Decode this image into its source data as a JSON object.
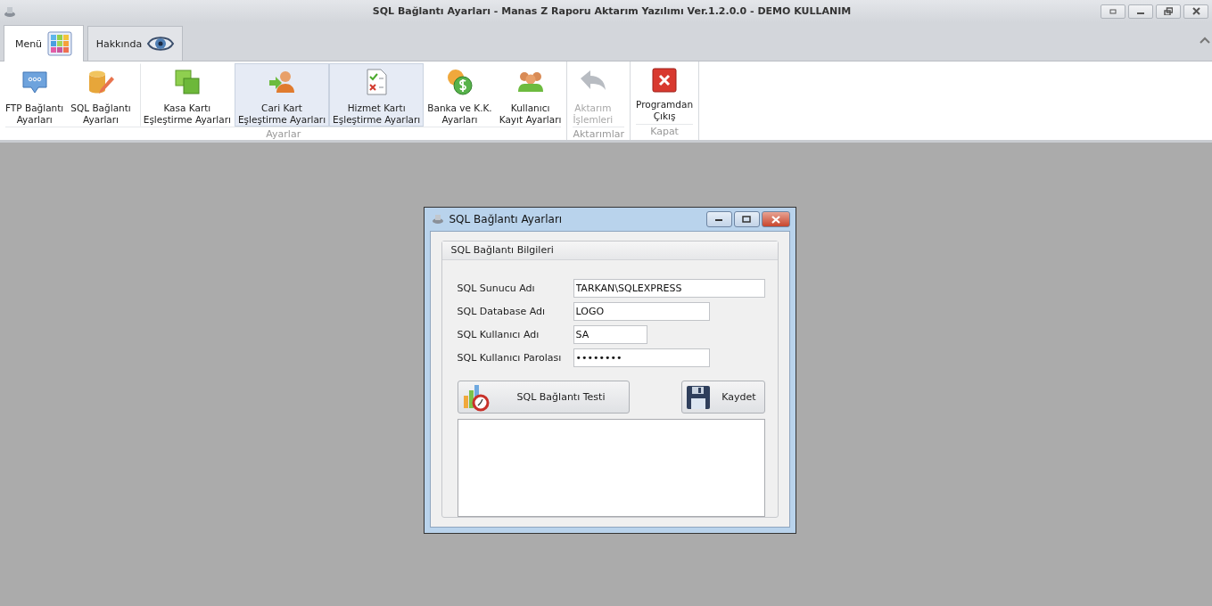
{
  "window": {
    "title": "SQL Bağlantı Ayarları - Manas Z Raporu Aktarım Yazılımı Ver.1.2.0.0 - DEMO KULLANIM"
  },
  "tabs": [
    {
      "label": "Menü",
      "selected": true
    },
    {
      "label": "Hakkında",
      "selected": false
    }
  ],
  "ribbon_groups": [
    {
      "label": "Ayarlar",
      "items": [
        {
          "label": "FTP Bağlantı\nAyarları",
          "highlighted": false,
          "disabled": false
        },
        {
          "label": "SQL Bağlantı\nAyarları",
          "highlighted": false,
          "disabled": false
        },
        {
          "label": "Kasa Kartı\nEşleştirme Ayarları",
          "highlighted": false,
          "disabled": false
        },
        {
          "label": "Cari Kart\nEşleştirme Ayarları",
          "highlighted": true,
          "disabled": false
        },
        {
          "label": "Hizmet Kartı\nEşleştirme Ayarları",
          "highlighted": true,
          "disabled": false
        },
        {
          "label": "Banka ve K.K.\nAyarları",
          "highlighted": false,
          "disabled": false
        },
        {
          "label": "Kullanıcı\nKayıt Ayarları",
          "highlighted": false,
          "disabled": false
        }
      ]
    },
    {
      "label": "Aktarımlar",
      "items": [
        {
          "label": "Aktarım\nİşlemleri",
          "highlighted": false,
          "disabled": true
        }
      ]
    },
    {
      "label": "Kapat",
      "items": [
        {
          "label": "Programdan\nÇıkış",
          "highlighted": false,
          "disabled": false
        }
      ]
    }
  ],
  "dialog": {
    "title": "SQL Bağlantı Ayarları",
    "group_title": "SQL Bağlantı Bilgileri",
    "fields": [
      {
        "label": "SQL Sunucu Adı",
        "value": "TARKAN\\SQLEXPRESS"
      },
      {
        "label": "SQL Database Adı",
        "value": "LOGO"
      },
      {
        "label": "SQL Kullanıcı Adı",
        "value": "SA"
      },
      {
        "label": "SQL Kullanıcı Parolası",
        "value": "••••••••"
      }
    ],
    "buttons": [
      "SQL Bağlantı Testi",
      "Kaydet"
    ]
  }
}
